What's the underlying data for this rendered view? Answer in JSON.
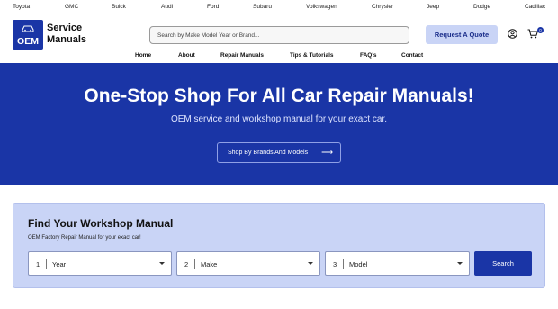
{
  "brands": [
    "Toyota",
    "GMC",
    "Buick",
    "Audi",
    "Ford",
    "Subaru",
    "Volkswagen",
    "Chrysler",
    "Jeep",
    "Dodge",
    "Cadillac"
  ],
  "logo": {
    "badge": "OEM",
    "line1": "Service",
    "line2": "Manuals",
    "brand_color": "#1a35a6"
  },
  "search": {
    "placeholder": "Search by Make Model Year or Brand..."
  },
  "header": {
    "quote_label": "Request A Quote",
    "cart_count": "0",
    "icons": [
      "user-icon",
      "cart-icon"
    ]
  },
  "nav": [
    "Home",
    "About",
    "Repair Manuals",
    "Tips & Tutorials",
    "FAQ's",
    "Contact"
  ],
  "hero": {
    "title": "One-Stop Shop For All Car Repair Manuals!",
    "subtitle": "OEM service and workshop manual for your exact car.",
    "cta": "Shop By Brands And Models"
  },
  "finder": {
    "title": "Find Your Workshop Manual",
    "desc": "OEM Factory Repair Manual for your exact car!",
    "selects": [
      {
        "num": "1",
        "label": "Year"
      },
      {
        "num": "2",
        "label": "Make"
      },
      {
        "num": "3",
        "label": "Model"
      }
    ],
    "button": "Search"
  }
}
